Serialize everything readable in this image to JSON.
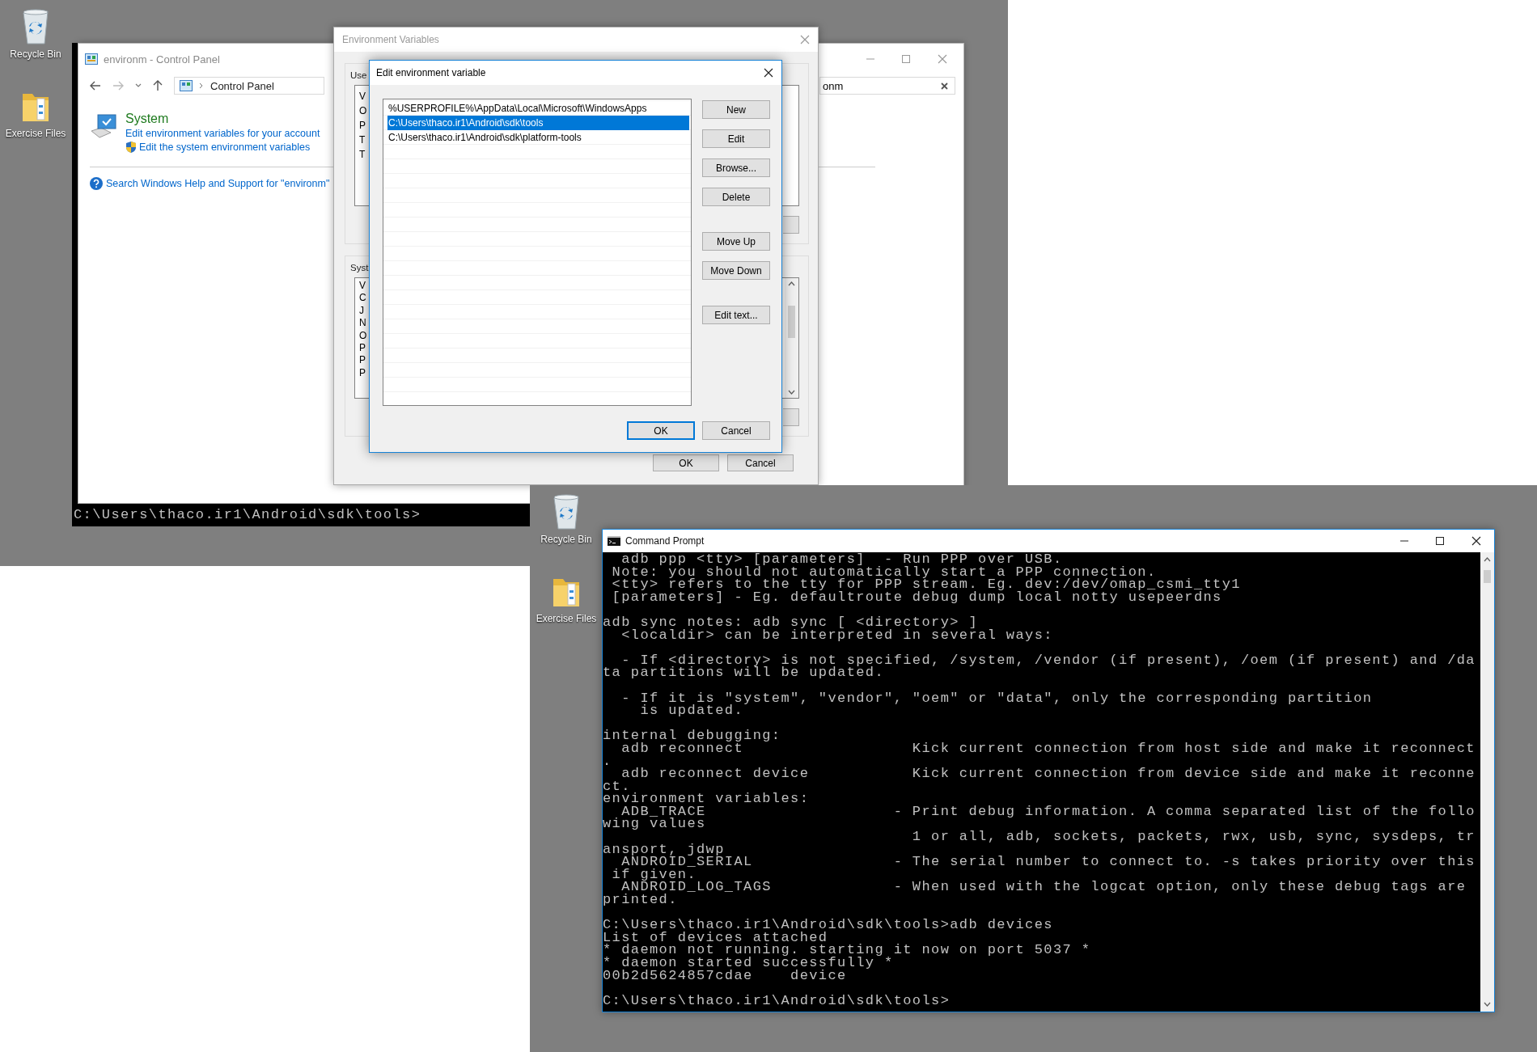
{
  "top_desktop": {
    "icons": [
      {
        "label": "Recycle Bin",
        "kind": "recycle-bin"
      },
      {
        "label": "Exercise Files",
        "kind": "folder"
      }
    ],
    "background_console": {
      "line": "C:\\Users\\thaco.ir1\\Android\\sdk\\tools>"
    },
    "control_panel": {
      "title": "environm - Control Panel",
      "address": "Control Panel",
      "search_value": "onm",
      "section_title": "System",
      "links": [
        {
          "text": "Edit environment variables for your account",
          "kind": "plain"
        },
        {
          "text": "Edit the system environment variables",
          "kind": "shield"
        }
      ],
      "help_link": "Search Windows Help and Support for \"environm\""
    },
    "environment_variables": {
      "title": "Environment Variables",
      "user_label": "Use",
      "user_rows": [
        "V",
        "O",
        "P",
        "T",
        "T"
      ],
      "system_label": "Syst",
      "system_rows": [
        "V",
        "C",
        "J",
        "N",
        "O",
        "P",
        "P",
        "P"
      ],
      "buttons": [
        "OK",
        "Cancel"
      ]
    },
    "edit_dialog": {
      "title": "Edit environment variable",
      "entries": [
        {
          "text": "%USERPROFILE%\\AppData\\Local\\Microsoft\\WindowsApps",
          "selected": false
        },
        {
          "text": "C:\\Users\\thaco.ir1\\Android\\sdk\\tools",
          "selected": true
        },
        {
          "text": "C:\\Users\\thaco.ir1\\Android\\sdk\\platform-tools",
          "selected": false
        }
      ],
      "button_groups": [
        [
          "New",
          "Edit",
          "Browse...",
          "Delete"
        ],
        [
          "Move Up",
          "Move Down"
        ],
        [
          "Edit text..."
        ]
      ],
      "ok": "OK",
      "cancel": "Cancel"
    }
  },
  "bottom_desktop": {
    "icons": [
      {
        "label": "Recycle Bin",
        "kind": "recycle-bin"
      },
      {
        "label": "Exercise Files",
        "kind": "folder"
      }
    ],
    "command_prompt": {
      "title": "Command Prompt",
      "blocks": [
        [
          "  adb ppp <tty> [parameters]  - Run PPP over USB.",
          " Note: you should not automatically start a PPP connection.",
          " <tty> refers to the tty for PPP stream. Eg. dev:/dev/omap_csmi_tty1",
          " [parameters] - Eg. defaultroute debug dump local notty usepeerdns"
        ],
        [
          "adb sync notes: adb sync [ <directory> ]",
          "  <localdir> can be interpreted in several ways:"
        ],
        [
          "  - If <directory> is not specified, /system, /vendor (if present), /oem (if present) and /da",
          "ta partitions will be updated."
        ],
        [
          "  - If it is \"system\", \"vendor\", \"oem\" or \"data\", only the corresponding partition",
          "    is updated."
        ],
        [
          "internal debugging:",
          "  adb reconnect                  Kick current connection from host side and make it reconnect",
          ".",
          "  adb reconnect device           Kick current connection from device side and make it reconne",
          "ct.",
          "environment variables:",
          "  ADB_TRACE                    - Print debug information. A comma separated list of the follo",
          "wing values",
          "                                 1 or all, adb, sockets, packets, rwx, usb, sync, sysdeps, tr",
          "ansport, jdwp",
          "  ANDROID_SERIAL               - The serial number to connect to. -s takes priority over this",
          " if given.",
          "  ANDROID_LOG_TAGS             - When used with the logcat option, only these debug tags are",
          "printed."
        ],
        [
          "C:\\Users\\thaco.ir1\\Android\\sdk\\tools>adb devices",
          "List of devices attached",
          "* daemon not running. starting it now on port 5037 *",
          "* daemon started successfully *",
          "00b2d5624857cdae    device"
        ],
        [
          "C:\\Users\\thaco.ir1\\Android\\sdk\\tools>"
        ]
      ]
    }
  }
}
